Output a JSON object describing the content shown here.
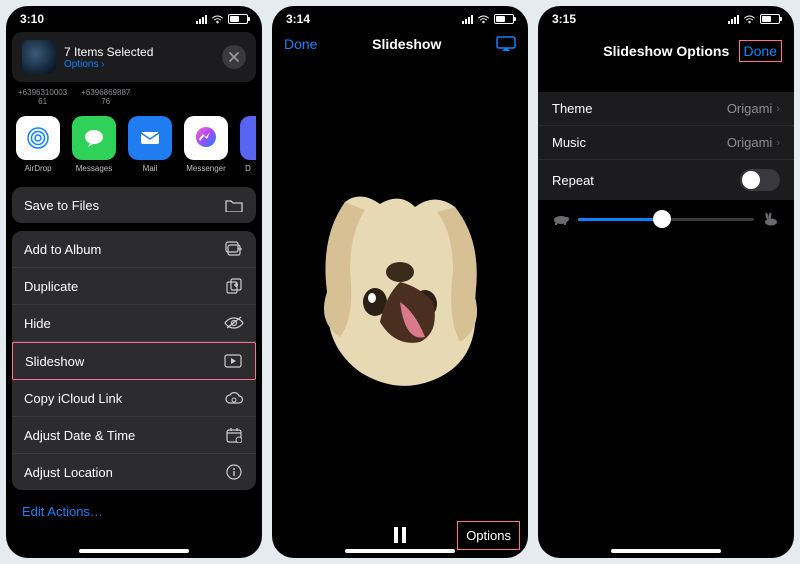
{
  "phone1": {
    "time": "3:10",
    "header": {
      "title": "7 Items Selected",
      "options": "Options",
      "chev": "›"
    },
    "contacts": [
      {
        "num": "+6396310003",
        "sub": "61"
      },
      {
        "num": "+6396869887",
        "sub": "76"
      }
    ],
    "apps": [
      {
        "id": "airdrop",
        "label": "AirDrop"
      },
      {
        "id": "messages",
        "label": "Messages"
      },
      {
        "id": "mail",
        "label": "Mail"
      },
      {
        "id": "messenger",
        "label": "Messenger"
      },
      {
        "id": "discord",
        "label": "D"
      }
    ],
    "save_group": [
      {
        "id": "save-files",
        "label": "Save to Files",
        "icon": "folder-icon"
      }
    ],
    "action_group": [
      {
        "id": "add-album",
        "label": "Add to Album",
        "icon": "album-icon"
      },
      {
        "id": "duplicate",
        "label": "Duplicate",
        "icon": "duplicate-icon"
      },
      {
        "id": "hide",
        "label": "Hide",
        "icon": "eye-off-icon"
      },
      {
        "id": "slideshow",
        "label": "Slideshow",
        "icon": "play-rect-icon",
        "highlight": true
      },
      {
        "id": "icloud",
        "label": "Copy iCloud Link",
        "icon": "cloud-icon"
      },
      {
        "id": "adjust-date",
        "label": "Adjust Date & Time",
        "icon": "calendar-icon"
      },
      {
        "id": "adjust-loc",
        "label": "Adjust Location",
        "icon": "info-icon"
      }
    ],
    "edit_actions": "Edit Actions…"
  },
  "phone2": {
    "time": "3:14",
    "done": "Done",
    "title": "Slideshow",
    "options": "Options"
  },
  "phone3": {
    "time": "3:15",
    "title": "Slideshow Options",
    "done": "Done",
    "rows": {
      "theme": {
        "label": "Theme",
        "value": "Origami"
      },
      "music": {
        "label": "Music",
        "value": "Origami"
      },
      "repeat": {
        "label": "Repeat",
        "on": false
      }
    },
    "speed": 0.48
  }
}
